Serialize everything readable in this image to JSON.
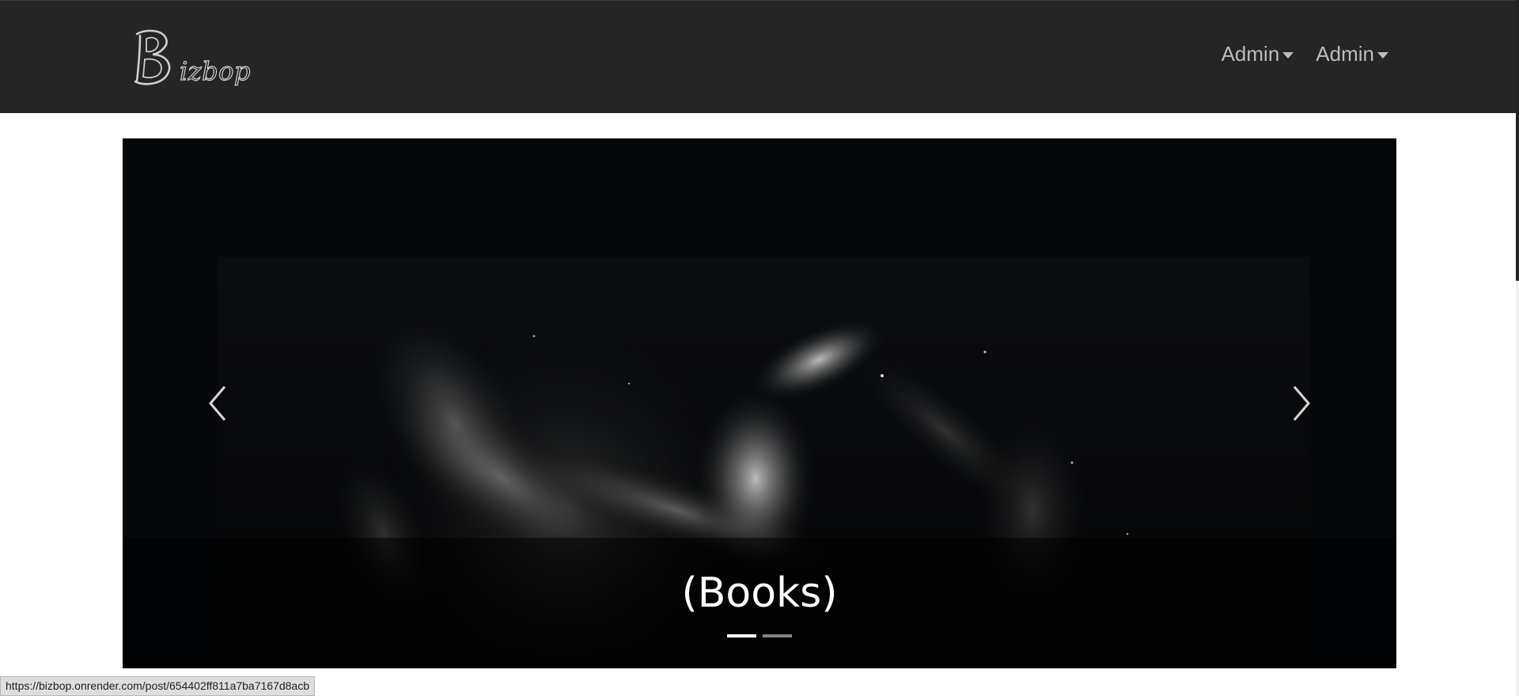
{
  "navbar": {
    "brand_text": "izbop",
    "menus": [
      {
        "label": "Admin"
      },
      {
        "label": "Admin"
      }
    ]
  },
  "carousel": {
    "caption": "(Books)",
    "slide_count": 2,
    "active_slide": 1
  },
  "statusbar": {
    "url": "https://bizbop.onrender.com/post/654402ff811a7ba7167d8acb"
  },
  "colors": {
    "navbar_bg": "#252525",
    "nav_text": "#bdbdbd",
    "carousel_bg": "#07080a"
  }
}
